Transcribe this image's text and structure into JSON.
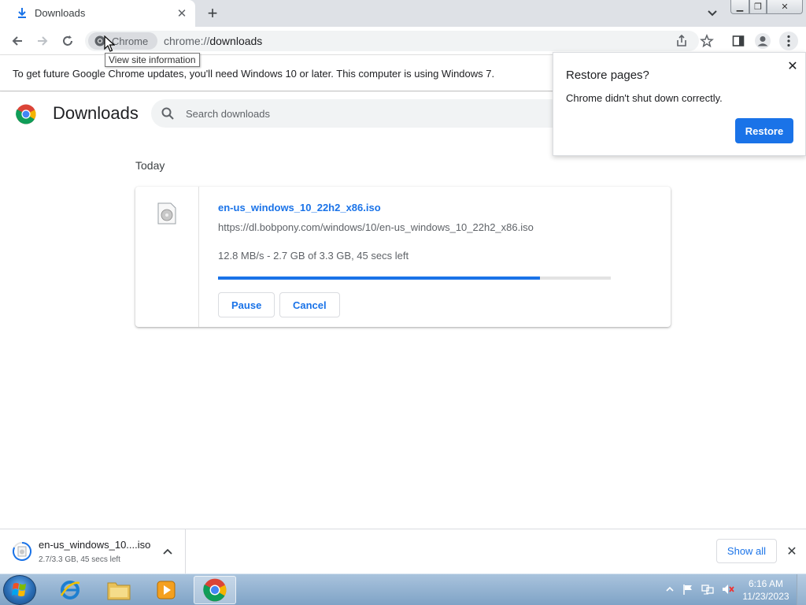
{
  "tab": {
    "title": "Downloads",
    "close_glyph": "✕",
    "new_tab_glyph": "+"
  },
  "window_controls": {
    "minimize": "▁",
    "maximize": "❐",
    "close": "✕"
  },
  "omnibox": {
    "chip_label": "Chrome",
    "url_scheme": "chrome://",
    "url_path": "downloads"
  },
  "tooltip": "View site information",
  "infobar": {
    "text": "To get future Google Chrome updates, you'll need Windows 10 or later. This computer is using Windows 7."
  },
  "page": {
    "title": "Downloads",
    "search_placeholder": "Search downloads",
    "date_group": "Today"
  },
  "download": {
    "file_name": "en-us_windows_10_22h2_x86.iso",
    "url": "https://dl.bobpony.com/windows/10/en-us_windows_10_22h2_x86.iso",
    "status": "12.8 MB/s - 2.7 GB of 3.3 GB, 45 secs left",
    "progress_fraction": 0.82,
    "pause_label": "Pause",
    "cancel_label": "Cancel"
  },
  "restore_dialog": {
    "title": "Restore pages?",
    "message": "Chrome didn't shut down correctly.",
    "button_label": "Restore",
    "close_glyph": "✕"
  },
  "shelf": {
    "file_name": "en-us_windows_10....iso",
    "status": "2.7/3.3 GB, 45 secs left",
    "show_all_label": "Show all",
    "close_glyph": "✕"
  },
  "taskbar": {
    "apps": [
      "internet-explorer",
      "file-explorer",
      "media-player",
      "chrome"
    ],
    "clock_time": "6:16 AM",
    "clock_date": "11/23/2023"
  },
  "colors": {
    "accent": "#1a73e8",
    "progress_track": "#e3e3e3"
  }
}
